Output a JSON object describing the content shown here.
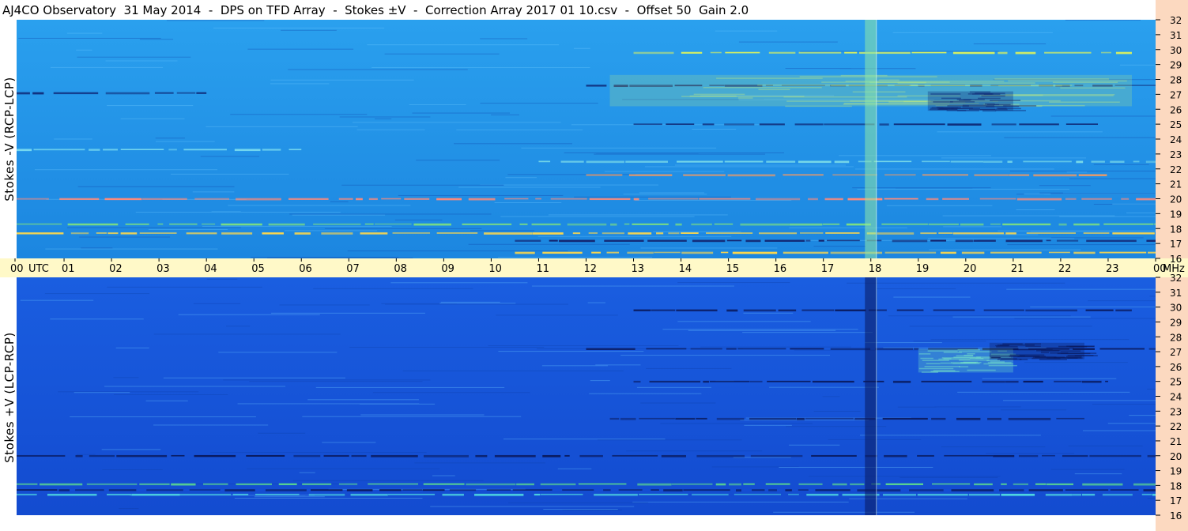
{
  "title": "AJ4CO Observatory  31 May 2014  -  DPS on TFD Array  -  Stokes ±V  -  Correction Array 2017 01 10.csv  -  Offset 50  Gain 2.0",
  "colors": {
    "top_background": "#1f8fe6",
    "bottom_background": "#1552d8",
    "axis_strip": "#fff9c8",
    "freq_strip": "#fcd9c0",
    "strong_burst": "#ffee55",
    "negative": "#0a1e6e"
  },
  "chart_data": [
    {
      "type": "heatmap",
      "title": "",
      "ylabel": "Stokes -V (RCP-LCP)",
      "xlabel": "",
      "x_ticks": [
        "00",
        "01",
        "02",
        "03",
        "04",
        "05",
        "06",
        "07",
        "08",
        "09",
        "10",
        "11",
        "12",
        "13",
        "14",
        "15",
        "16",
        "17",
        "18",
        "19",
        "20",
        "21",
        "22",
        "23",
        "00"
      ],
      "x_unit_label": "UTC",
      "xlim_hours_utc": [
        0,
        24
      ],
      "y_ticks": [
        16,
        17,
        18,
        19,
        20,
        21,
        22,
        23,
        24,
        25,
        26,
        27,
        28,
        29,
        30,
        31,
        32
      ],
      "ylim_mhz": [
        16,
        32
      ],
      "y_unit_label": "MHz",
      "features": [
        {
          "kind": "hline",
          "freq_mhz": 20.0,
          "t_start": 0.0,
          "t_end": 24.0,
          "color": "#ff8a7a"
        },
        {
          "kind": "hline",
          "freq_mhz": 17.7,
          "t_start": 0.0,
          "t_end": 24.0,
          "color": "#ffd84a"
        },
        {
          "kind": "hline",
          "freq_mhz": 18.3,
          "t_start": 0.0,
          "t_end": 24.0,
          "color": "#7ee07e"
        },
        {
          "kind": "hline",
          "freq_mhz": 17.2,
          "t_start": 10.5,
          "t_end": 24.0,
          "color": "#12206b"
        },
        {
          "kind": "hline",
          "freq_mhz": 16.4,
          "t_start": 10.5,
          "t_end": 24.0,
          "color": "#ffd84a"
        },
        {
          "kind": "hline",
          "freq_mhz": 25.0,
          "t_start": 13.0,
          "t_end": 23.0,
          "color": "#0f2a77"
        },
        {
          "kind": "hline",
          "freq_mhz": 21.6,
          "t_start": 12.0,
          "t_end": 23.0,
          "color": "#ff9a5a"
        },
        {
          "kind": "hline",
          "freq_mhz": 22.5,
          "t_start": 11.0,
          "t_end": 24.0,
          "color": "#78d8e8"
        },
        {
          "kind": "hline",
          "freq_mhz": 29.8,
          "t_start": 13.0,
          "t_end": 23.5,
          "color": "#d8f060"
        },
        {
          "kind": "hline",
          "freq_mhz": 27.6,
          "t_start": 12.0,
          "t_end": 24.0,
          "color": "#10307e"
        },
        {
          "kind": "hline",
          "freq_mhz": 27.1,
          "t_start": 0.0,
          "t_end": 4.0,
          "color": "#10307e"
        },
        {
          "kind": "hline",
          "freq_mhz": 23.3,
          "t_start": 0.0,
          "t_end": 6.0,
          "color": "#7adcf0"
        },
        {
          "kind": "patch",
          "t_start": 12.5,
          "t_end": 23.5,
          "f_low": 26.2,
          "f_high": 28.3,
          "color": "#c8f07a",
          "opacity": 0.35
        },
        {
          "kind": "patch",
          "t_start": 19.2,
          "t_end": 21.0,
          "f_low": 25.9,
          "f_high": 27.2,
          "color": "#0f2a77",
          "opacity": 0.55
        },
        {
          "kind": "vline",
          "t": 18.0,
          "f_low": 16.0,
          "f_high": 32.0,
          "color": "#8ee6a8",
          "width_hours": 0.25
        }
      ]
    },
    {
      "type": "heatmap",
      "title": "",
      "ylabel": "Stokes +V (LCP-RCP)",
      "xlabel": "",
      "x_ticks": [
        "00",
        "01",
        "02",
        "03",
        "04",
        "05",
        "06",
        "07",
        "08",
        "09",
        "10",
        "11",
        "12",
        "13",
        "14",
        "15",
        "16",
        "17",
        "18",
        "19",
        "20",
        "21",
        "22",
        "23",
        "00"
      ],
      "x_unit_label": "UTC",
      "xlim_hours_utc": [
        0,
        24
      ],
      "y_ticks": [
        16,
        17,
        18,
        19,
        20,
        21,
        22,
        23,
        24,
        25,
        26,
        27,
        28,
        29,
        30,
        31,
        32
      ],
      "ylim_mhz": [
        16,
        32
      ],
      "y_unit_label": "MHz",
      "features": [
        {
          "kind": "hline",
          "freq_mhz": 20.0,
          "t_start": 0.0,
          "t_end": 24.0,
          "color": "#0a1a5e"
        },
        {
          "kind": "hline",
          "freq_mhz": 17.7,
          "t_start": 0.0,
          "t_end": 24.0,
          "color": "#0a1a5e"
        },
        {
          "kind": "hline",
          "freq_mhz": 17.4,
          "t_start": 0.0,
          "t_end": 24.0,
          "color": "#4fd8e0"
        },
        {
          "kind": "hline",
          "freq_mhz": 18.1,
          "t_start": 0.0,
          "t_end": 24.0,
          "color": "#5fe08a"
        },
        {
          "kind": "hline",
          "freq_mhz": 25.0,
          "t_start": 13.0,
          "t_end": 23.0,
          "color": "#0a1a5e"
        },
        {
          "kind": "hline",
          "freq_mhz": 27.2,
          "t_start": 12.0,
          "t_end": 24.0,
          "color": "#0a1a5e"
        },
        {
          "kind": "hline",
          "freq_mhz": 29.8,
          "t_start": 13.0,
          "t_end": 23.5,
          "color": "#0a1a5e"
        },
        {
          "kind": "hline",
          "freq_mhz": 22.5,
          "t_start": 12.5,
          "t_end": 22.5,
          "color": "#0c1f66"
        },
        {
          "kind": "patch",
          "t_start": 19.0,
          "t_end": 21.0,
          "f_low": 25.6,
          "f_high": 27.2,
          "color": "#7ef0c8",
          "opacity": 0.45
        },
        {
          "kind": "patch",
          "t_start": 20.5,
          "t_end": 22.5,
          "f_low": 26.5,
          "f_high": 27.6,
          "color": "#0a1a5e",
          "opacity": 0.55
        },
        {
          "kind": "vline",
          "t": 18.0,
          "f_low": 16.0,
          "f_high": 32.0,
          "color": "#0a1a5e",
          "width_hours": 0.25
        }
      ]
    }
  ]
}
